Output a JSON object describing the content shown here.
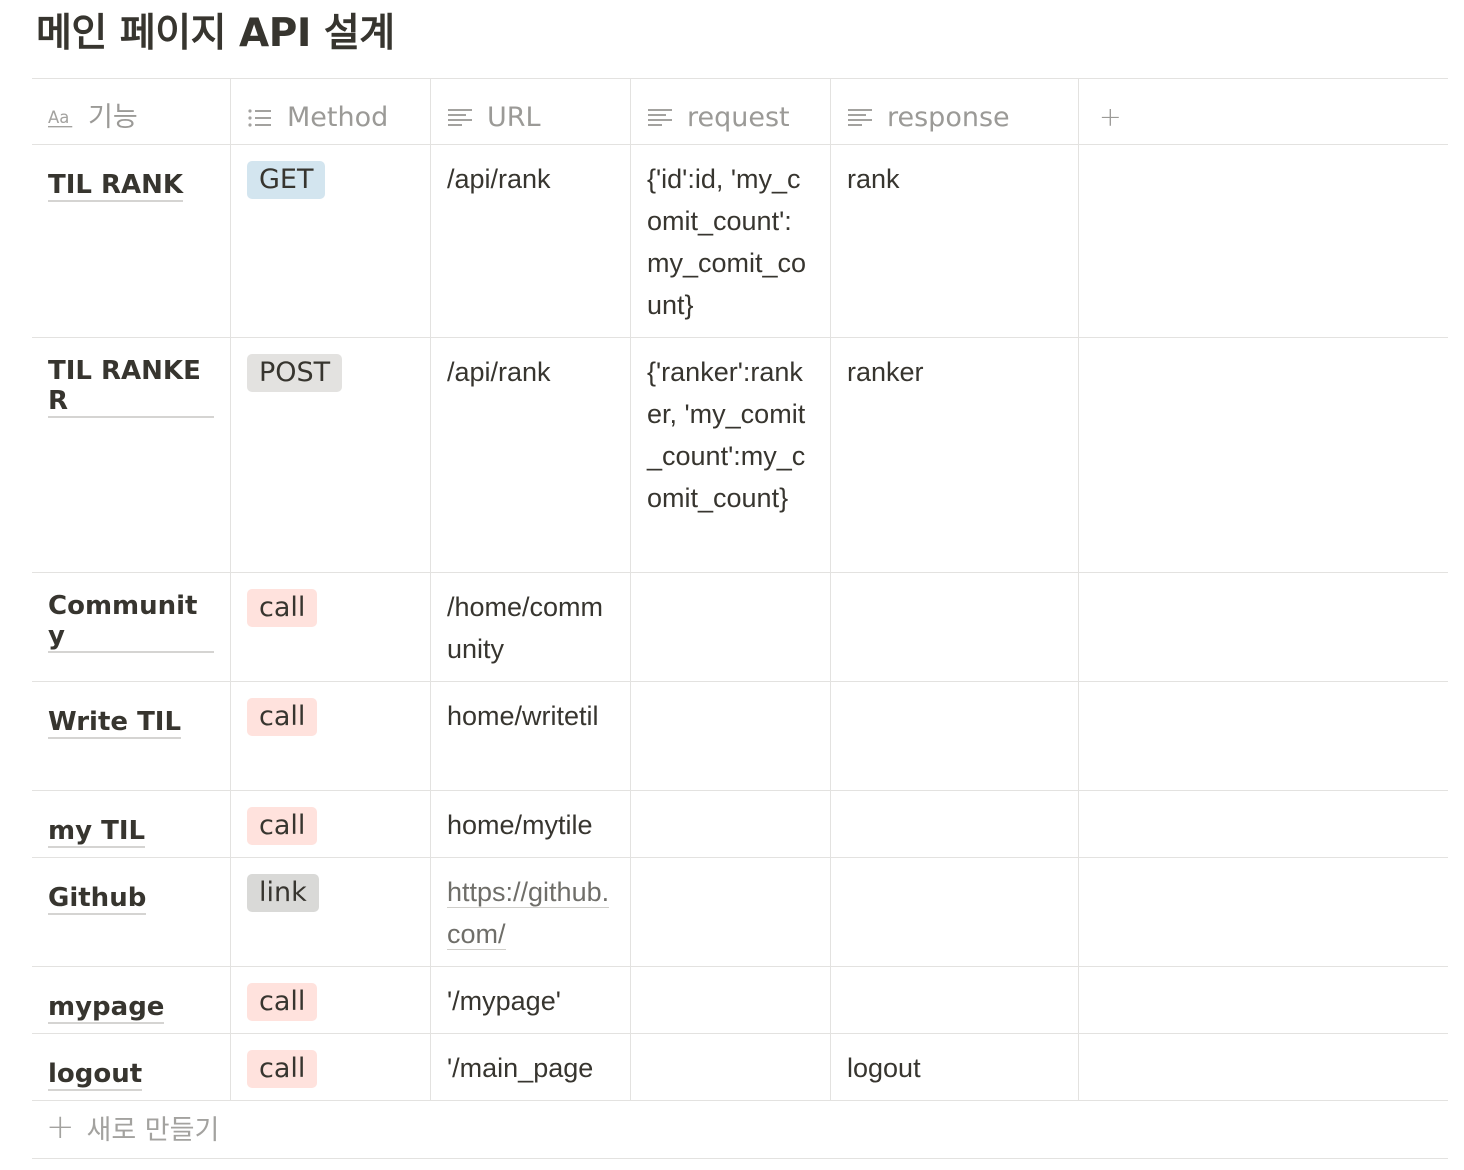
{
  "title": "메인 페이지 API 설계",
  "columns": [
    {
      "label": "기능",
      "icon": "title-icon"
    },
    {
      "label": "Method",
      "icon": "list-icon"
    },
    {
      "label": "URL",
      "icon": "text-lines-icon"
    },
    {
      "label": "request",
      "icon": "text-lines-icon"
    },
    {
      "label": "response",
      "icon": "text-lines-icon"
    }
  ],
  "add_column_label": "+",
  "tag_colors": {
    "blue": "#d3e5ef",
    "gray": "#e3e2e0",
    "red": "#ffe2dd",
    "dark_gray": "#d9d9d7"
  },
  "rows": [
    {
      "name": "TIL RANK",
      "method": "GET",
      "method_color": "blue",
      "url": "/api/rank",
      "request": "{'id':id, 'my_comit_count':my_comit_count}",
      "response": "rank"
    },
    {
      "name": "TIL RANKER",
      "method": "POST",
      "method_color": "gray",
      "url": "/api/rank",
      "request": "{'ranker':ranker, 'my_comit_count':my_comit_count}",
      "response": "ranker"
    },
    {
      "name": "Community",
      "method": "call",
      "method_color": "red",
      "url": "/home/community",
      "request": "",
      "response": ""
    },
    {
      "name": "Write TIL",
      "method": "call",
      "method_color": "red",
      "url": "home/writetil",
      "request": "",
      "response": ""
    },
    {
      "name": "my TIL",
      "method": "call",
      "method_color": "red",
      "url": "home/mytile",
      "request": "",
      "response": ""
    },
    {
      "name": "Github",
      "method": "link",
      "method_color": "dark_gray",
      "url": "https://github.com/",
      "request": "",
      "response": ""
    },
    {
      "name": "mypage",
      "method": "call",
      "method_color": "red",
      "url": "'/mypage'",
      "request": "",
      "response": ""
    },
    {
      "name": "logout",
      "method": "call",
      "method_color": "red",
      "url": "'/main_page",
      "request": "",
      "response": "logout"
    }
  ],
  "new_row_label": "새로 만들기"
}
